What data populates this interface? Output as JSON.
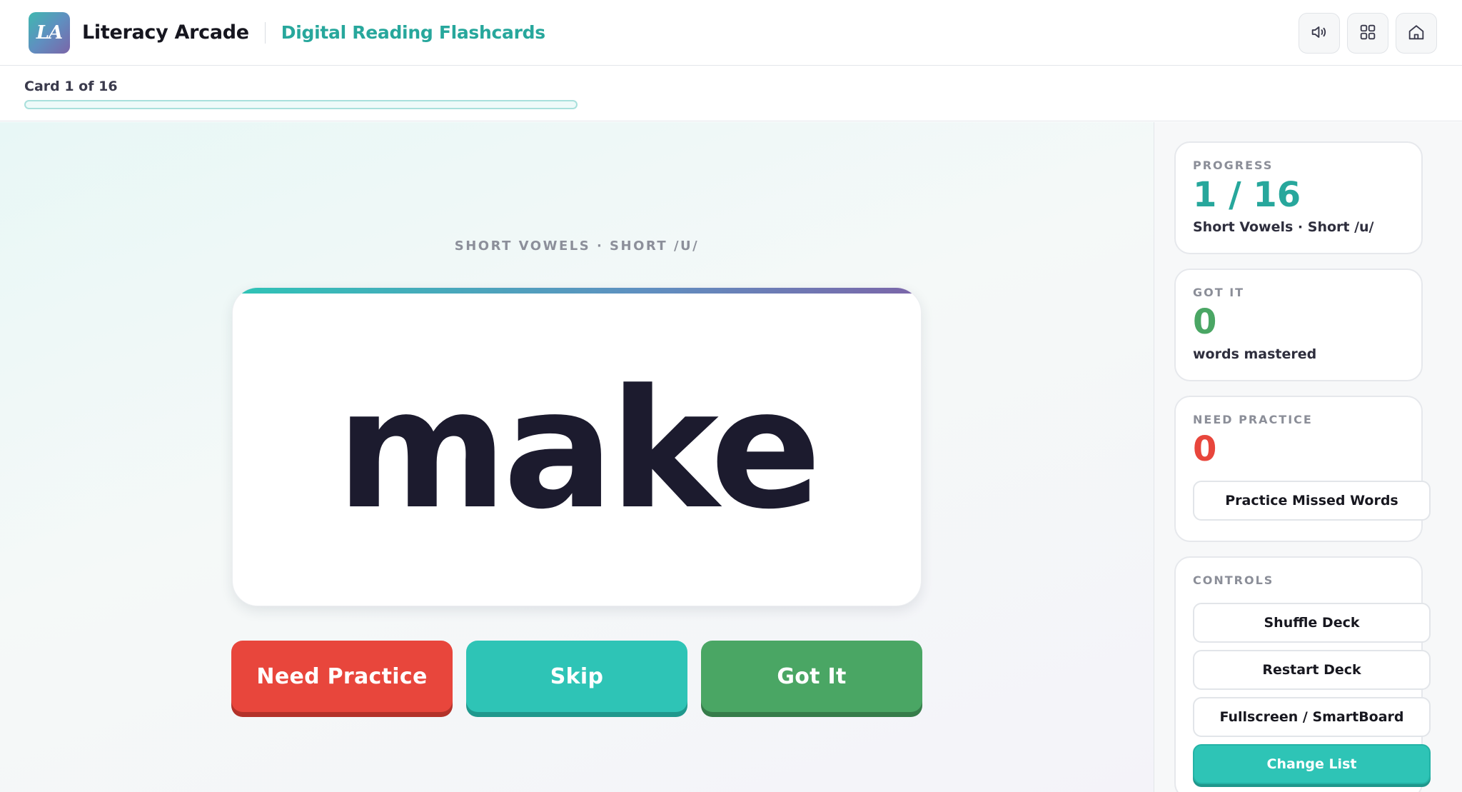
{
  "header": {
    "logo_text": "LA",
    "app_title": "Literacy Arcade",
    "subtitle": "Digital Reading Flashcards",
    "icons": [
      "speaker-icon",
      "grid-icon",
      "home-icon"
    ]
  },
  "progress_strip": {
    "card_count": "Card 1 of 16",
    "progress_fraction": 0
  },
  "flashcard": {
    "category": "SHORT VOWELS · SHORT /U/",
    "word": "make"
  },
  "actions": {
    "need_practice": "Need Practice",
    "skip": "Skip",
    "got_it": "Got It"
  },
  "sidebar": {
    "progress": {
      "label": "PROGRESS",
      "value": "1 / 16",
      "sub": "Short Vowels · Short /u/"
    },
    "got_it": {
      "label": "GOT IT",
      "value": "0",
      "sub": "words mastered"
    },
    "need_practice": {
      "label": "NEED PRACTICE",
      "value": "0",
      "button": "Practice Missed Words"
    },
    "controls": {
      "label": "CONTROLS",
      "shuffle": "Shuffle Deck",
      "restart": "Restart Deck",
      "fullscreen": "Fullscreen / SmartBoard",
      "change_list": "Change List"
    }
  },
  "colors": {
    "teal": "#2ec4b6",
    "red": "#e8463c",
    "green": "#4aa664",
    "ink": "#1c1b2e"
  }
}
